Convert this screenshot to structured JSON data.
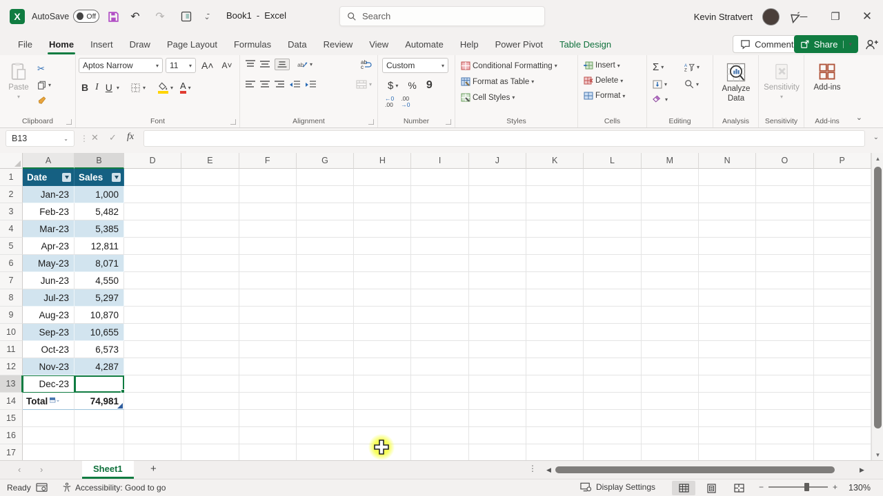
{
  "title_bar": {
    "app_logo": "X",
    "autosave_label": "AutoSave",
    "autosave_state": "Off",
    "doc_name": "Book1",
    "dash": "-",
    "app_name": "Excel",
    "search_placeholder": "Search",
    "user_name": "Kevin Stratvert"
  },
  "ribbon_tabs": {
    "items": [
      "File",
      "Home",
      "Insert",
      "Draw",
      "Page Layout",
      "Formulas",
      "Data",
      "Review",
      "View",
      "Automate",
      "Help",
      "Power Pivot",
      "Table Design"
    ],
    "active": "Home",
    "contextual": "Table Design",
    "comments_label": "Comments",
    "share_label": "Share"
  },
  "ribbon": {
    "clipboard": {
      "label": "Clipboard",
      "paste": "Paste"
    },
    "font": {
      "label": "Font",
      "name": "Aptos Narrow",
      "size": "11",
      "bold": "B",
      "italic": "I",
      "underline": "U",
      "color_letter": "A"
    },
    "alignment": {
      "label": "Alignment",
      "wrap": "ab"
    },
    "number": {
      "label": "Number",
      "format": "Custom",
      "currency": "$",
      "percent": "%",
      "comma": "9",
      "inc_dec": "←0 .00",
      "dec_dec": ".00 →0"
    },
    "styles": {
      "label": "Styles",
      "conditional": "Conditional Formatting",
      "format_table": "Format as Table",
      "cell_styles": "Cell Styles"
    },
    "cells": {
      "label": "Cells",
      "insert": "Insert",
      "delete": "Delete",
      "format": "Format"
    },
    "editing": {
      "label": "Editing",
      "autosum": "Σ"
    },
    "analysis": {
      "label": "Analysis",
      "button": "Analyze Data"
    },
    "sensitivity": {
      "label": "Sensitivity",
      "button": "Sensitivity"
    },
    "addins": {
      "label": "Add-ins",
      "button": "Add-ins"
    }
  },
  "formula_bar": {
    "name_box": "B13",
    "fx": "fx",
    "formula": ""
  },
  "grid": {
    "columns": [
      "A",
      "B",
      "D",
      "E",
      "F",
      "G",
      "H",
      "I",
      "J",
      "K",
      "L",
      "M",
      "N",
      "O",
      "P"
    ],
    "row_count": 17,
    "selected_cell": "B13",
    "highlighted_columns": [
      "A",
      "B"
    ],
    "highlighted_row": 13
  },
  "table": {
    "headers": [
      "Date",
      "Sales"
    ],
    "rows": [
      [
        "Jan-23",
        "1,000"
      ],
      [
        "Feb-23",
        "5,482"
      ],
      [
        "Mar-23",
        "5,385"
      ],
      [
        "Apr-23",
        "12,811"
      ],
      [
        "May-23",
        "8,071"
      ],
      [
        "Jun-23",
        "4,550"
      ],
      [
        "Jul-23",
        "5,297"
      ],
      [
        "Aug-23",
        "10,870"
      ],
      [
        "Sep-23",
        "10,655"
      ],
      [
        "Oct-23",
        "6,573"
      ],
      [
        "Nov-23",
        "4,287"
      ],
      [
        "Dec-23",
        ""
      ]
    ],
    "total_label": "Total",
    "total_value": "74,981",
    "colors": {
      "header_bg": "#156082",
      "band_bg": "#d2e4ef",
      "selection_border": "#0f7b41",
      "accent_green": "#107c41"
    }
  },
  "sheet_bar": {
    "active_tab": "Sheet1",
    "add_label": "+"
  },
  "status_bar": {
    "mode": "Ready",
    "accessibility": "Accessibility: Good to go",
    "display_settings": "Display Settings",
    "zoom_level": "130%"
  }
}
